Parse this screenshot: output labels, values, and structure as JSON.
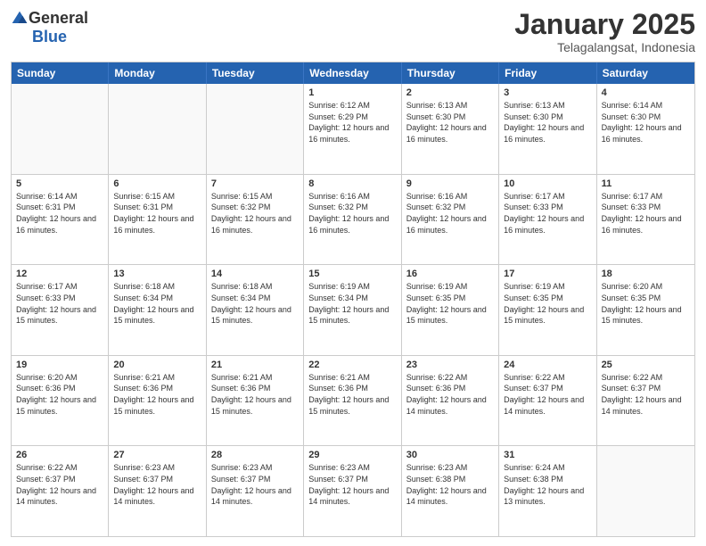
{
  "header": {
    "logo_general": "General",
    "logo_blue": "Blue",
    "month_title": "January 2025",
    "location": "Telagalangsat, Indonesia"
  },
  "weekdays": [
    "Sunday",
    "Monday",
    "Tuesday",
    "Wednesday",
    "Thursday",
    "Friday",
    "Saturday"
  ],
  "weeks": [
    [
      {
        "day": "",
        "info": ""
      },
      {
        "day": "",
        "info": ""
      },
      {
        "day": "",
        "info": ""
      },
      {
        "day": "1",
        "info": "Sunrise: 6:12 AM\nSunset: 6:29 PM\nDaylight: 12 hours and 16 minutes."
      },
      {
        "day": "2",
        "info": "Sunrise: 6:13 AM\nSunset: 6:30 PM\nDaylight: 12 hours and 16 minutes."
      },
      {
        "day": "3",
        "info": "Sunrise: 6:13 AM\nSunset: 6:30 PM\nDaylight: 12 hours and 16 minutes."
      },
      {
        "day": "4",
        "info": "Sunrise: 6:14 AM\nSunset: 6:30 PM\nDaylight: 12 hours and 16 minutes."
      }
    ],
    [
      {
        "day": "5",
        "info": "Sunrise: 6:14 AM\nSunset: 6:31 PM\nDaylight: 12 hours and 16 minutes."
      },
      {
        "day": "6",
        "info": "Sunrise: 6:15 AM\nSunset: 6:31 PM\nDaylight: 12 hours and 16 minutes."
      },
      {
        "day": "7",
        "info": "Sunrise: 6:15 AM\nSunset: 6:32 PM\nDaylight: 12 hours and 16 minutes."
      },
      {
        "day": "8",
        "info": "Sunrise: 6:16 AM\nSunset: 6:32 PM\nDaylight: 12 hours and 16 minutes."
      },
      {
        "day": "9",
        "info": "Sunrise: 6:16 AM\nSunset: 6:32 PM\nDaylight: 12 hours and 16 minutes."
      },
      {
        "day": "10",
        "info": "Sunrise: 6:17 AM\nSunset: 6:33 PM\nDaylight: 12 hours and 16 minutes."
      },
      {
        "day": "11",
        "info": "Sunrise: 6:17 AM\nSunset: 6:33 PM\nDaylight: 12 hours and 16 minutes."
      }
    ],
    [
      {
        "day": "12",
        "info": "Sunrise: 6:17 AM\nSunset: 6:33 PM\nDaylight: 12 hours and 15 minutes."
      },
      {
        "day": "13",
        "info": "Sunrise: 6:18 AM\nSunset: 6:34 PM\nDaylight: 12 hours and 15 minutes."
      },
      {
        "day": "14",
        "info": "Sunrise: 6:18 AM\nSunset: 6:34 PM\nDaylight: 12 hours and 15 minutes."
      },
      {
        "day": "15",
        "info": "Sunrise: 6:19 AM\nSunset: 6:34 PM\nDaylight: 12 hours and 15 minutes."
      },
      {
        "day": "16",
        "info": "Sunrise: 6:19 AM\nSunset: 6:35 PM\nDaylight: 12 hours and 15 minutes."
      },
      {
        "day": "17",
        "info": "Sunrise: 6:19 AM\nSunset: 6:35 PM\nDaylight: 12 hours and 15 minutes."
      },
      {
        "day": "18",
        "info": "Sunrise: 6:20 AM\nSunset: 6:35 PM\nDaylight: 12 hours and 15 minutes."
      }
    ],
    [
      {
        "day": "19",
        "info": "Sunrise: 6:20 AM\nSunset: 6:36 PM\nDaylight: 12 hours and 15 minutes."
      },
      {
        "day": "20",
        "info": "Sunrise: 6:21 AM\nSunset: 6:36 PM\nDaylight: 12 hours and 15 minutes."
      },
      {
        "day": "21",
        "info": "Sunrise: 6:21 AM\nSunset: 6:36 PM\nDaylight: 12 hours and 15 minutes."
      },
      {
        "day": "22",
        "info": "Sunrise: 6:21 AM\nSunset: 6:36 PM\nDaylight: 12 hours and 15 minutes."
      },
      {
        "day": "23",
        "info": "Sunrise: 6:22 AM\nSunset: 6:36 PM\nDaylight: 12 hours and 14 minutes."
      },
      {
        "day": "24",
        "info": "Sunrise: 6:22 AM\nSunset: 6:37 PM\nDaylight: 12 hours and 14 minutes."
      },
      {
        "day": "25",
        "info": "Sunrise: 6:22 AM\nSunset: 6:37 PM\nDaylight: 12 hours and 14 minutes."
      }
    ],
    [
      {
        "day": "26",
        "info": "Sunrise: 6:22 AM\nSunset: 6:37 PM\nDaylight: 12 hours and 14 minutes."
      },
      {
        "day": "27",
        "info": "Sunrise: 6:23 AM\nSunset: 6:37 PM\nDaylight: 12 hours and 14 minutes."
      },
      {
        "day": "28",
        "info": "Sunrise: 6:23 AM\nSunset: 6:37 PM\nDaylight: 12 hours and 14 minutes."
      },
      {
        "day": "29",
        "info": "Sunrise: 6:23 AM\nSunset: 6:37 PM\nDaylight: 12 hours and 14 minutes."
      },
      {
        "day": "30",
        "info": "Sunrise: 6:23 AM\nSunset: 6:38 PM\nDaylight: 12 hours and 14 minutes."
      },
      {
        "day": "31",
        "info": "Sunrise: 6:24 AM\nSunset: 6:38 PM\nDaylight: 12 hours and 13 minutes."
      },
      {
        "day": "",
        "info": ""
      }
    ]
  ]
}
